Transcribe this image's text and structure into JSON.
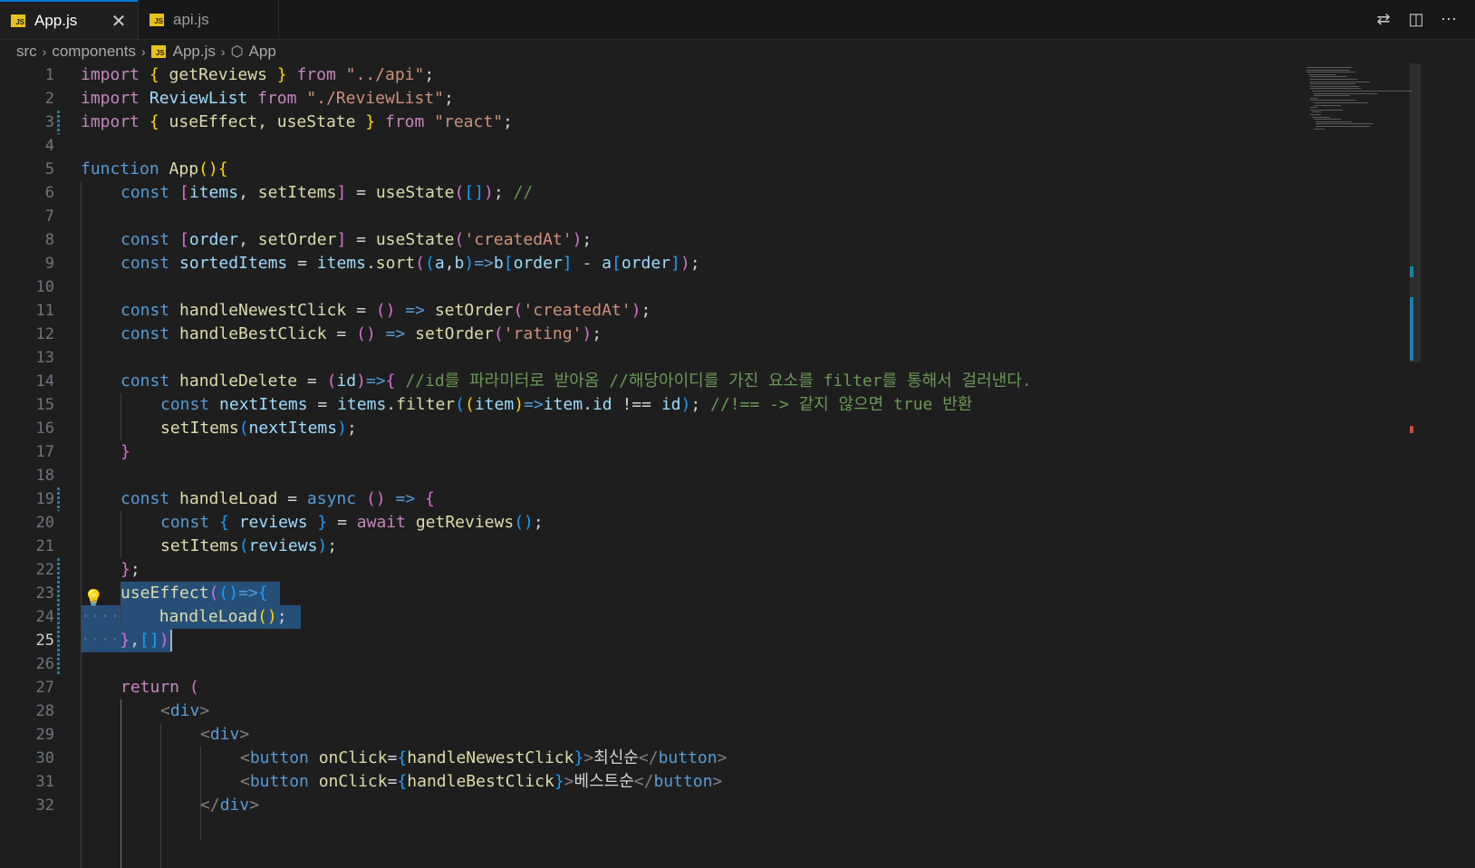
{
  "tabs": [
    {
      "label": "App.js",
      "badge": "JS",
      "active": true,
      "close": "✕"
    },
    {
      "label": "api.js",
      "badge": "JS",
      "active": false
    }
  ],
  "top_actions": [
    {
      "icon": "source-control-compare-icon",
      "glyph": "⇄"
    },
    {
      "icon": "split-editor-icon",
      "glyph": "◫"
    },
    {
      "icon": "more-actions-icon",
      "glyph": "⋯"
    }
  ],
  "breadcrumb": {
    "items": [
      "src",
      "components",
      "App.js",
      "App"
    ],
    "separator": "›"
  },
  "editor": {
    "current_line": 25,
    "line_numbers": [
      "1",
      "2",
      "3",
      "4",
      "5",
      "6",
      "7",
      "8",
      "9",
      "10",
      "11",
      "12",
      "13",
      "14",
      "15",
      "16",
      "17",
      "18",
      "19",
      "20",
      "21",
      "22",
      "23",
      "24",
      "25",
      "26",
      "27",
      "28",
      "29",
      "30",
      "31",
      "32"
    ],
    "lines": {
      "l1": [
        "import",
        " ",
        "{",
        " getReviews ",
        "}",
        " from ",
        "\"../api\"",
        ";"
      ],
      "l2": [
        "import",
        " ReviewList ",
        "from",
        " ",
        "\"./ReviewList\"",
        ";"
      ],
      "l3": [
        "import",
        " ",
        "{",
        " useEffect, useState ",
        "}",
        " from ",
        "\"react\"",
        ";"
      ],
      "l5": [
        "function",
        " ",
        "App",
        "()",
        "{"
      ],
      "l6": [
        "const",
        " ",
        "[",
        "items",
        ", ",
        "setItems",
        "]",
        " = ",
        "useState",
        "(",
        "[]",
        ")",
        "; ",
        "//"
      ],
      "l8": [
        "const",
        " ",
        "[",
        "order",
        ", ",
        "setOrder",
        "]",
        " = ",
        "useState",
        "(",
        "'createdAt'",
        ")",
        ";"
      ],
      "l9": [
        "const",
        " ",
        "sortedItems",
        " = ",
        "items",
        ".",
        "sort",
        "(",
        "(",
        "a",
        ",",
        "b",
        ")",
        "=>",
        "b",
        "[",
        "order",
        "]",
        " - ",
        "a",
        "[",
        "order",
        "]",
        ")",
        ";"
      ],
      "l11": [
        "const",
        " ",
        "handleNewestClick",
        " = ",
        "()",
        " => ",
        "setOrder",
        "(",
        "'createdAt'",
        ")",
        ";"
      ],
      "l12": [
        "const",
        " ",
        "handleBestClick",
        " = ",
        "()",
        " => ",
        "setOrder",
        "(",
        "'rating'",
        ")",
        ";"
      ],
      "l14": [
        "const",
        " ",
        "handleDelete",
        " = ",
        "(",
        "id",
        ")",
        "=>",
        "{",
        " ",
        "//id를 파라미터로 받아옴 //해당아이디를 가진 요소를 filter를 통해서 걸러낸다."
      ],
      "l15": [
        "const",
        " ",
        "nextItems",
        " = ",
        "items",
        ".",
        "filter",
        "(",
        "(",
        "item",
        ")",
        "=>",
        "item",
        ".",
        "id",
        " !== ",
        "id",
        ")",
        "; ",
        "//!== -> 같지 않으면 true 반환"
      ],
      "l16": [
        "setItems",
        "(",
        "nextItems",
        ")",
        ";"
      ],
      "l17": [
        "}"
      ],
      "l19": [
        "const",
        " ",
        "handleLoad",
        " = ",
        "async",
        " ",
        "()",
        " => ",
        "{"
      ],
      "l20": [
        "const",
        " ",
        "{",
        " ",
        "reviews",
        " ",
        "}",
        " = ",
        "await",
        " ",
        "getReviews",
        "()",
        ";"
      ],
      "l21": [
        "setItems",
        "(",
        "reviews",
        ")",
        ";"
      ],
      "l22": [
        "}",
        ";"
      ],
      "l23": [
        "useEffect",
        "(",
        "()",
        "=>",
        "{"
      ],
      "l24": [
        "handleLoad",
        "()",
        ";"
      ],
      "l25": [
        "}",
        ",",
        "[]",
        ")"
      ],
      "l27": [
        "return",
        " ",
        "("
      ],
      "l28": [
        "<",
        "div",
        ">"
      ],
      "l29": [
        "<",
        "div",
        ">"
      ],
      "l30": [
        "<",
        "button",
        " ",
        "onClick",
        "=",
        "{",
        "handleNewestClick",
        "}",
        ">",
        "최신순",
        "</",
        "button",
        ">"
      ],
      "l31": [
        "<",
        "button",
        " ",
        "onClick",
        "=",
        "{",
        "handleBestClick",
        "}",
        ">",
        "베스트순",
        "</",
        "button",
        ">"
      ],
      "l32": [
        "</",
        "div",
        ">"
      ]
    },
    "whitespace_dots": "····"
  },
  "colors": {
    "background": "#1e1e1e",
    "tab_accent": "#0078d4",
    "selection": "#264f78",
    "keyword": "#c586c0",
    "storage": "#569cd6",
    "function": "#dcdcaa",
    "variable": "#9cdcfe",
    "string": "#ce9178",
    "comment": "#6a9955",
    "js_badge": "#e8c21a"
  },
  "icons": {
    "js_file": "js-file-icon",
    "symbol": "symbol-class-icon",
    "lightbulb": "lightbulb-icon",
    "lightbulb_glyph": "💡",
    "cube_glyph": "⬡"
  }
}
